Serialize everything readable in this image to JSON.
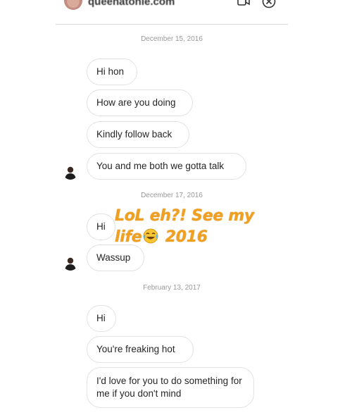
{
  "header": {
    "username": "queenatonle.com",
    "video_icon": "video-camera-icon",
    "close_icon": "close-icon"
  },
  "overlay": {
    "line1": "LoL eh?! See my",
    "line2_prefix": "life",
    "emoji": "face-with-tears-of-joy-icon",
    "line2_suffix": "2016",
    "color": "#f0a020"
  },
  "chat": {
    "dates": [
      "December 15, 2016",
      "December 17, 2016",
      "February 13, 2017"
    ],
    "messages": [
      "Hi hon",
      "How are you doing",
      "Kindly follow back",
      "You and me both we gotta talk",
      "Hi",
      "Wassup",
      "Hi",
      "You're freaking hot",
      "I'd love for you to do something for me if you don't mind"
    ]
  }
}
